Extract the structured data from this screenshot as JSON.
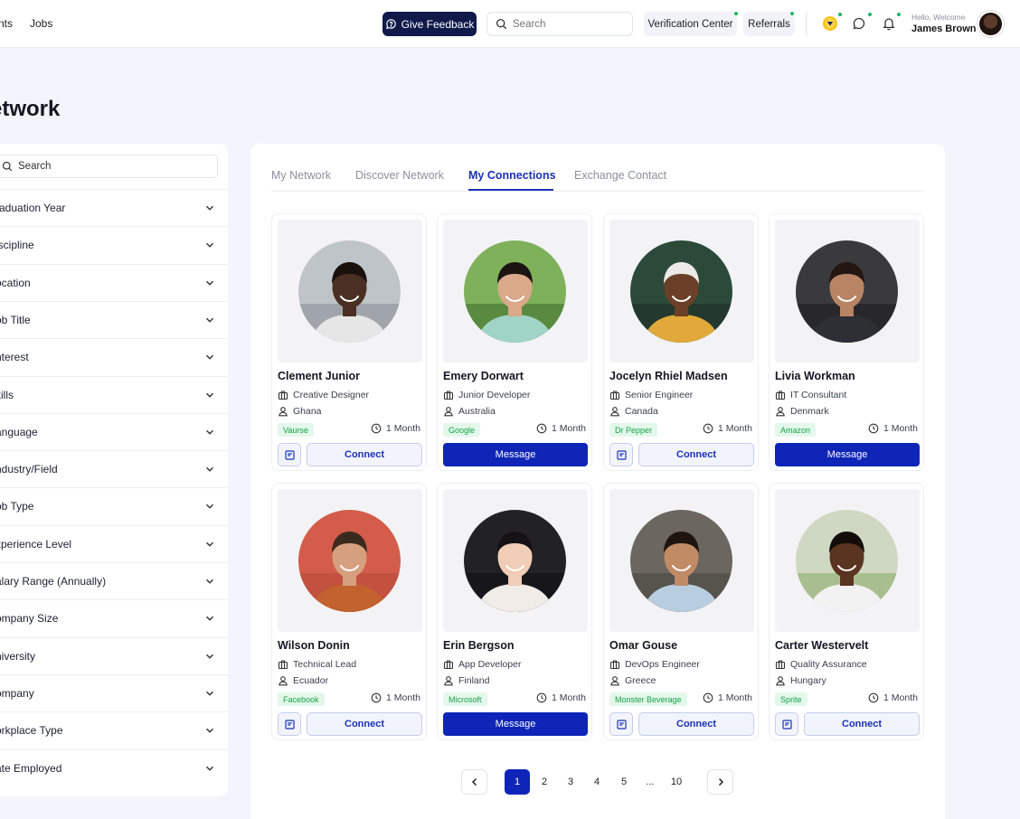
{
  "nav": {
    "links": [
      "nts",
      "Jobs"
    ],
    "feedback_label": "Give Feedback",
    "search_placeholder": "Search",
    "verification_label": "Verification Center",
    "referrals_label": "Referrals",
    "welcome_text": "Hello, Welcome",
    "user_name": "James Brown"
  },
  "page": {
    "title": "etwork"
  },
  "filters": {
    "search_placeholder": "Search",
    "items": [
      "raduation Year",
      "iscipline",
      "ocation",
      "ob Title",
      "nterest",
      "kills",
      "anguage",
      "ndustry/Field",
      "ob Type",
      "xperience Level",
      "alary Range (Annually)",
      "ompany Size",
      "niversity",
      "ompany",
      "orkplace Type",
      "ate Employed"
    ]
  },
  "tabs": [
    "My Network",
    "Discover Network",
    "My Connections",
    "Exchange Contact"
  ],
  "active_tab": "My Connections",
  "colors": {
    "accent": "#1b32b8",
    "primary_button": "#0f25b8",
    "feedback_button": "#0f1a4a",
    "badge_bg": "#e3f7ea",
    "badge_text": "#17a34a",
    "notification_dot": "#1fb86a"
  },
  "cards": [
    {
      "name": "Clement Junior",
      "role": "Creative Designer",
      "country": "Ghana",
      "company": "Vaurse",
      "duration": "1 Month",
      "action": "Connect"
    },
    {
      "name": "Emery Dorwart",
      "role": "Junior Developer",
      "country": "Australia",
      "company": "Google",
      "duration": "1 Month",
      "action": "Message"
    },
    {
      "name": "Jocelyn Rhiel Madsen",
      "role": "Senior Engineer",
      "country": "Canada",
      "company": "Dr Pepper",
      "duration": "1 Month",
      "action": "Connect"
    },
    {
      "name": "Livia Workman",
      "role": "IT Consultant",
      "country": "Denmark",
      "company": "Amazon",
      "duration": "1 Month",
      "action": "Message"
    },
    {
      "name": "Wilson Donin",
      "role": "Technical Lead",
      "country": "Ecuador",
      "company": "Facebook",
      "duration": "1 Month",
      "action": "Connect"
    },
    {
      "name": "Erin Bergson",
      "role": "App Developer",
      "country": "Finland",
      "company": "Microsoft",
      "duration": "1 Month",
      "action": "Message"
    },
    {
      "name": "Omar Gouse",
      "role": "DevOps Engineer",
      "country": "Greece",
      "company": "Monster Beverage",
      "duration": "1 Month",
      "action": "Connect"
    },
    {
      "name": "Carter Westervelt",
      "role": "Quality Assurance",
      "country": "Hungary",
      "company": "Sprite",
      "duration": "1 Month",
      "action": "Connect"
    }
  ],
  "pagination": {
    "pages": [
      "1",
      "2",
      "3",
      "4",
      "5",
      "...",
      "10"
    ],
    "current": "1"
  },
  "icons": {
    "feedback": "chat-bubble-icon",
    "search": "search-icon",
    "coin": "coin-icon",
    "messages": "message-icon",
    "notifications": "bell-icon",
    "chevron": "chevron-down-icon",
    "role": "briefcase-icon",
    "country": "user-icon",
    "duration": "clock-icon",
    "note": "note-icon"
  }
}
